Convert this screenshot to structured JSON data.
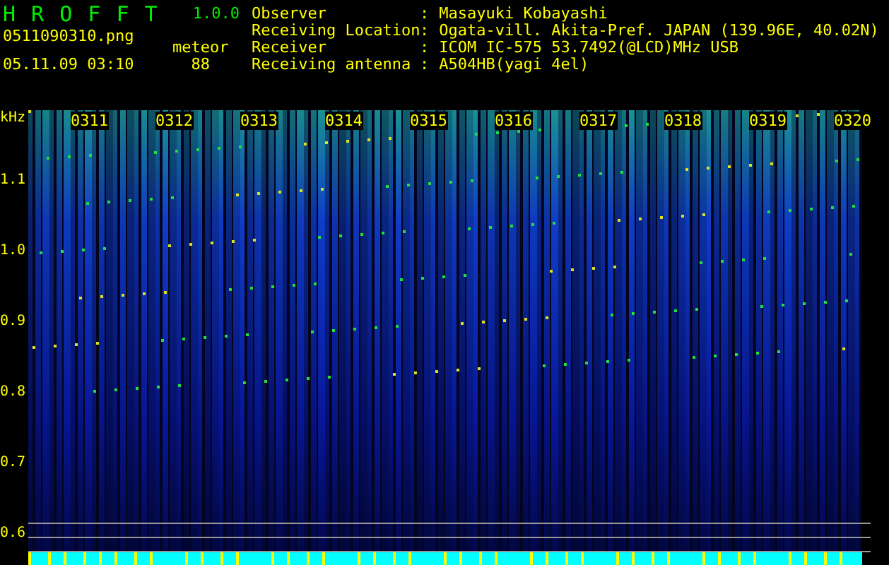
{
  "app": {
    "title": "H R O F F T",
    "version": "1.0.0",
    "file": "0511090310.png",
    "timestamp": "05.11.09 03:10",
    "meteor_label": "meteor",
    "meteor_count": "88"
  },
  "info": [
    {
      "label": "Observer",
      "separator": ":",
      "value": "Masayuki Kobayashi"
    },
    {
      "label": "Receiving Location",
      "separator": ":",
      "value": "Ogata-vill. Akita-Pref. JAPAN (139.96E, 40.02N)"
    },
    {
      "label": "Receiver",
      "separator": ":",
      "value": "ICOM IC-575 53.7492(@LCD)MHz USB"
    },
    {
      "label": "Receiving antenna",
      "separator": ":",
      "value": "A504HB(yagi 4el)"
    }
  ],
  "spectrogram": {
    "unit": "kHz",
    "y_labels": [
      "1.1",
      "1.0",
      "0.9",
      "0.8",
      "0.7",
      "0.6"
    ],
    "time_labels": [
      "0311",
      "0312",
      "0313",
      "0314",
      "0315",
      "0316",
      "0317",
      "0318",
      "0319",
      "0320"
    ]
  }
}
